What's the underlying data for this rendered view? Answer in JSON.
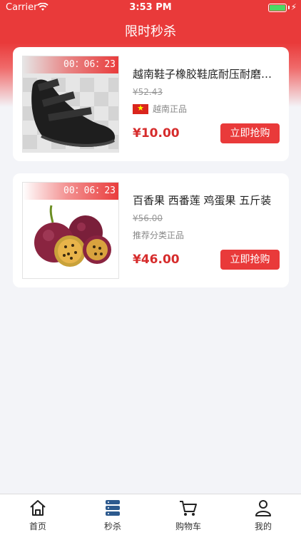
{
  "status_bar": {
    "carrier": "Carrier",
    "time": "3:53 PM"
  },
  "nav": {
    "title": "限时秒杀"
  },
  "products": [
    {
      "countdown": "00：06：23",
      "title": "越南鞋子橡胶鞋底耐压耐磨凉鞋",
      "original_price": "¥52.43",
      "origin": "越南正品",
      "price": "¥10.00",
      "buy_label": "立即抢购",
      "image": "black-sandal"
    },
    {
      "countdown": "00：06：23",
      "title": "百香果 西番莲 鸡蛋果 五斤装",
      "original_price": "¥56.00",
      "origin": "推荐分类正品",
      "price": "¥46.00",
      "buy_label": "立即抢购",
      "image": "passion-fruit"
    }
  ],
  "tab_bar": {
    "tabs": [
      {
        "label": "首页",
        "icon": "home-icon"
      },
      {
        "label": "秒杀",
        "icon": "flash-sale-icon"
      },
      {
        "label": "购物车",
        "icon": "cart-icon"
      },
      {
        "label": "我的",
        "icon": "user-icon"
      }
    ]
  },
  "colors": {
    "accent": "#e93a3a",
    "price": "#d62c2c",
    "flag_red": "#da251d"
  }
}
